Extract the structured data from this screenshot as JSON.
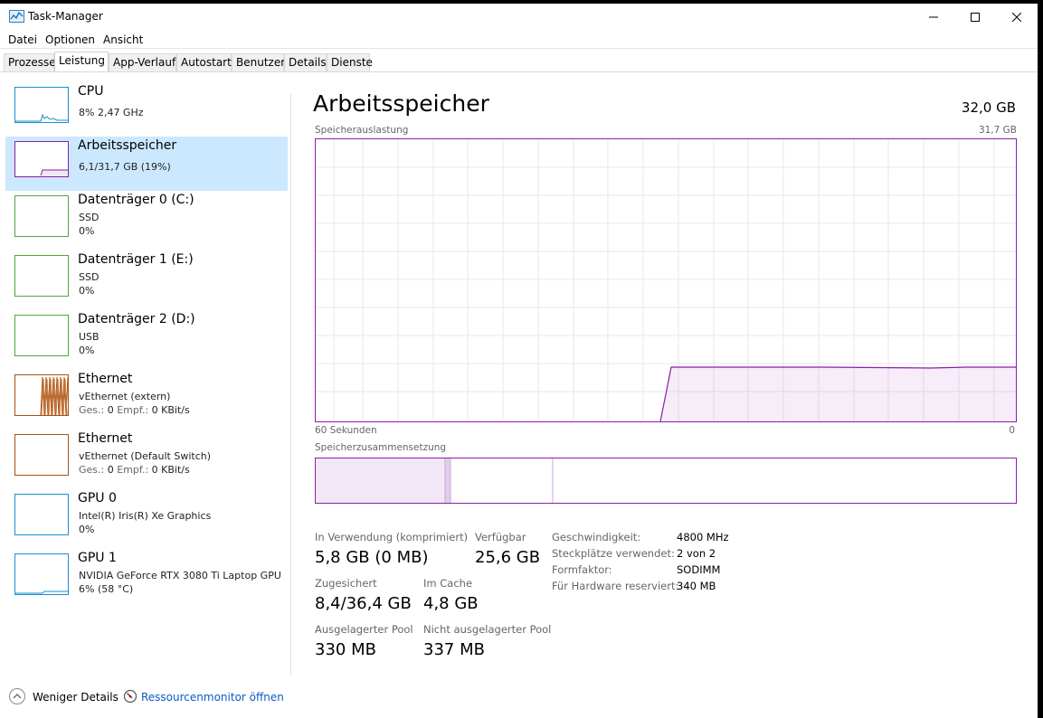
{
  "window": {
    "title": "Task-Manager"
  },
  "menu": [
    "Datei",
    "Optionen",
    "Ansicht"
  ],
  "tabs": [
    "Prozesse",
    "Leistung",
    "App-Verlauf",
    "Autostart",
    "Benutzer",
    "Details",
    "Dienste"
  ],
  "active_tab": "Leistung",
  "sidebar": {
    "items": [
      {
        "title": "CPU",
        "line1": "8% 2,47 GHz",
        "color": "#1a8fd1"
      },
      {
        "title": "Arbeitsspeicher",
        "line1": "6,1/31,7 GB (19%)",
        "color": "#8b1ea6"
      },
      {
        "title": "Datenträger 0 (C:)",
        "line1": "SSD",
        "line2": "0%",
        "color": "#4fa83d"
      },
      {
        "title": "Datenträger 1 (E:)",
        "line1": "SSD",
        "line2": "0%",
        "color": "#4fa83d"
      },
      {
        "title": "Datenträger 2 (D:)",
        "line1": "USB",
        "line2": "0%",
        "color": "#4fa83d"
      },
      {
        "title": "Ethernet",
        "line1": "vEthernet (extern)",
        "line2_label_send": "Ges.:",
        "line2_send": "0",
        "line2_label_recv": "Empf.:",
        "line2_recv": "0 KBit/s",
        "color": "#a75212"
      },
      {
        "title": "Ethernet",
        "line1": "vEthernet (Default Switch)",
        "line2_label_send": "Ges.:",
        "line2_send": "0",
        "line2_label_recv": "Empf.:",
        "line2_recv": "0 KBit/s",
        "color": "#a75212"
      },
      {
        "title": "GPU 0",
        "line1": "Intel(R) Iris(R) Xe Graphics",
        "line2": "0%",
        "color": "#1a8fd1"
      },
      {
        "title": "GPU 1",
        "line1": "NVIDIA GeForce RTX 3080 Ti Laptop GPU",
        "line2": "6% (58 °C)",
        "color": "#1a8fd1"
      }
    ]
  },
  "main": {
    "heading": "Arbeitsspeicher",
    "total": "32,0 GB",
    "graph_label": "Speicherauslastung",
    "graph_max": "31,7 GB",
    "graph_time_left": "60 Sekunden",
    "graph_time_right": "0",
    "composition_label": "Speicherzusammensetzung",
    "stats": {
      "in_use_label": "In Verwendung (komprimiert)",
      "in_use_value": "5,8 GB (0 MB)",
      "available_label": "Verfügbar",
      "available_value": "25,6 GB",
      "committed_label": "Zugesichert",
      "committed_value": "8,4/36,4 GB",
      "cached_label": "Im Cache",
      "cached_value": "4,8 GB",
      "paged_label": "Ausgelagerter Pool",
      "paged_value": "330 MB",
      "nonpaged_label": "Nicht ausgelagerter Pool",
      "nonpaged_value": "337 MB"
    },
    "details": [
      {
        "label": "Geschwindigkeit:",
        "value": "4800 MHz"
      },
      {
        "label": "Steckplätze verwendet:",
        "value": "2 von 2"
      },
      {
        "label": "Formfaktor:",
        "value": "SODIMM"
      },
      {
        "label": "Für Hardware reserviert:",
        "value": "340 MB"
      }
    ]
  },
  "footer": {
    "fewer_details": "Weniger Details",
    "resource_monitor": "Ressourcenmonitor öffnen"
  },
  "accent": "#8b1ea6"
}
